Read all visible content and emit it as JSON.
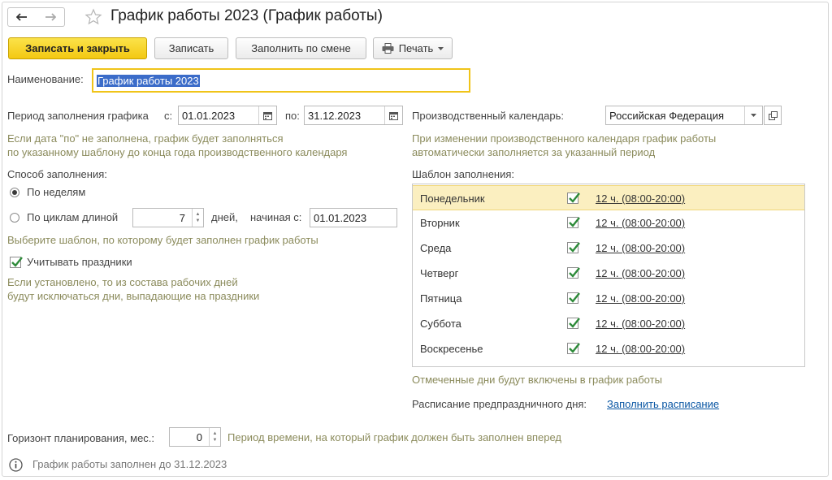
{
  "window": {
    "title": "График работы 2023 (График работы)"
  },
  "toolbar": {
    "save_close": "Записать и закрыть",
    "save": "Записать",
    "fill_by_shift": "Заполнить по смене",
    "print": "Печать"
  },
  "name_field": {
    "label": "Наименование:",
    "value": "График работы 2023"
  },
  "period": {
    "label": "Период заполнения графика",
    "from_label": "с:",
    "from_value": "01.01.2023",
    "to_label": "по:",
    "to_value": "31.12.2023",
    "hint_line1": "Если дата \"по\" не заполнена, график будет заполняться",
    "hint_line2": "по указанному шаблону до конца года производственного календаря"
  },
  "fill_method": {
    "label": "Способ заполнения:",
    "by_weeks": "По неделям",
    "by_cycles": "По циклам длиной",
    "cycle_length": "7",
    "days_label": "дней,",
    "starting_label": "начиная с:",
    "starting_value": "01.01.2023",
    "hint": "Выберите шаблон, по которому будет заполнен график работы",
    "holidays_label": "Учитывать праздники",
    "holidays_hint_line1": "Если установлено, то из состава рабочих дней",
    "holidays_hint_line2": "будут исключаться дни, выпадающие на праздники"
  },
  "calendar": {
    "label": "Производственный календарь:",
    "value": "Российская Федерация",
    "hint_line1": "При изменении производственного календаря график работы",
    "hint_line2": "автоматически заполняется за указанный период"
  },
  "template": {
    "label": "Шаблон заполнения:",
    "rows": [
      {
        "day": "Понедельник",
        "hours": "12 ч. (08:00-20:00)"
      },
      {
        "day": "Вторник",
        "hours": "12 ч. (08:00-20:00)"
      },
      {
        "day": "Среда",
        "hours": "12 ч. (08:00-20:00)"
      },
      {
        "day": "Четверг",
        "hours": "12 ч. (08:00-20:00)"
      },
      {
        "day": "Пятница",
        "hours": "12 ч. (08:00-20:00)"
      },
      {
        "day": "Суббота",
        "hours": "12 ч. (08:00-20:00)"
      },
      {
        "day": "Воскресенье",
        "hours": "12 ч. (08:00-20:00)"
      }
    ],
    "hint": "Отмеченные дни будут включены в график работы",
    "preholiday_label": "Расписание предпраздничного дня:",
    "preholiday_link": "Заполнить расписание"
  },
  "horizon": {
    "label": "Горизонт планирования, мес.:",
    "value": "0",
    "hint": "Период времени, на который график должен быть заполнен вперед"
  },
  "status": {
    "text": "График работы заполнен до 31.12.2023"
  },
  "colors": {
    "primary_button": "#f5cf1c",
    "hint_text": "#8b8b5c",
    "checkmark": "#2e8b3a",
    "link": "#0b57a4",
    "selected_row": "#fbefc0"
  }
}
